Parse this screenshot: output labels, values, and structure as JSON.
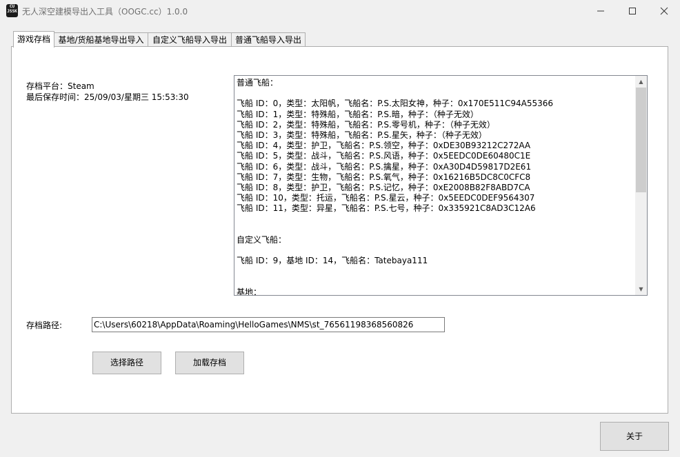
{
  "window": {
    "title": "无人深空建模导出入工具（OOGC.cc）1.0.0",
    "icon_text": "CU\nJSSK"
  },
  "tabs": [
    {
      "label": "游戏存档",
      "active": true
    },
    {
      "label": "基地/货船基地导出导入"
    },
    {
      "label": "自定义飞船导入导出"
    },
    {
      "label": "普通飞船导入导出"
    }
  ],
  "save_info": {
    "platform": "存档平台：Steam",
    "last_saved": "最后保存时间：25/09/03/星期三 15:53:30"
  },
  "ships_text": "普通飞船：\n\n飞船 ID：0，类型：太阳帆，飞船名：P.S.太阳女神，种子：0x170E511C94A55366\n飞船 ID：1，类型：特殊船，飞船名：P.S.暗，种子：（种子无效）\n飞船 ID：2，类型：特殊船，飞船名：P.S.零号机，种子：（种子无效）\n飞船 ID：3，类型：特殊船，飞船名：P.S.星矢，种子：（种子无效）\n飞船 ID：4，类型：护卫，飞船名：P.S.领空，种子：0xDE30B93212C272AA\n飞船 ID：5，类型：战斗，飞船名：P.S.风语，种子：0x5EEDC0DE60480C1E\n飞船 ID：6，类型：战斗，飞船名：P.S.擒星，种子：0xA30D4D59817D2E61\n飞船 ID：7，类型：生物，飞船名：P.S.氧气，种子：0x16216B5DC8C0CFC8\n飞船 ID：8，类型：护卫，飞船名：P.S.记忆，种子：0xE2008B82F8ABD7CA\n飞船 ID：10，类型：托运，飞船名：P.S.星云，种子：0x5EEDC0DEF9564307\n飞船 ID：11，类型：异星，飞船名：P.S.七号，种子：0x335921C8AD3C12A6\n\n\n自定义飞船：\n\n飞船 ID：9，基地 ID：14，飞船名：Tatebaya111\n\n\n基地：",
  "path": {
    "label": "存档路径:",
    "value": "C:\\Users\\60218\\AppData\\Roaming\\HelloGames\\NMS\\st_76561198368560826"
  },
  "buttons": {
    "choose_path": "选择路径",
    "load_save": "加载存档",
    "about": "关于"
  }
}
